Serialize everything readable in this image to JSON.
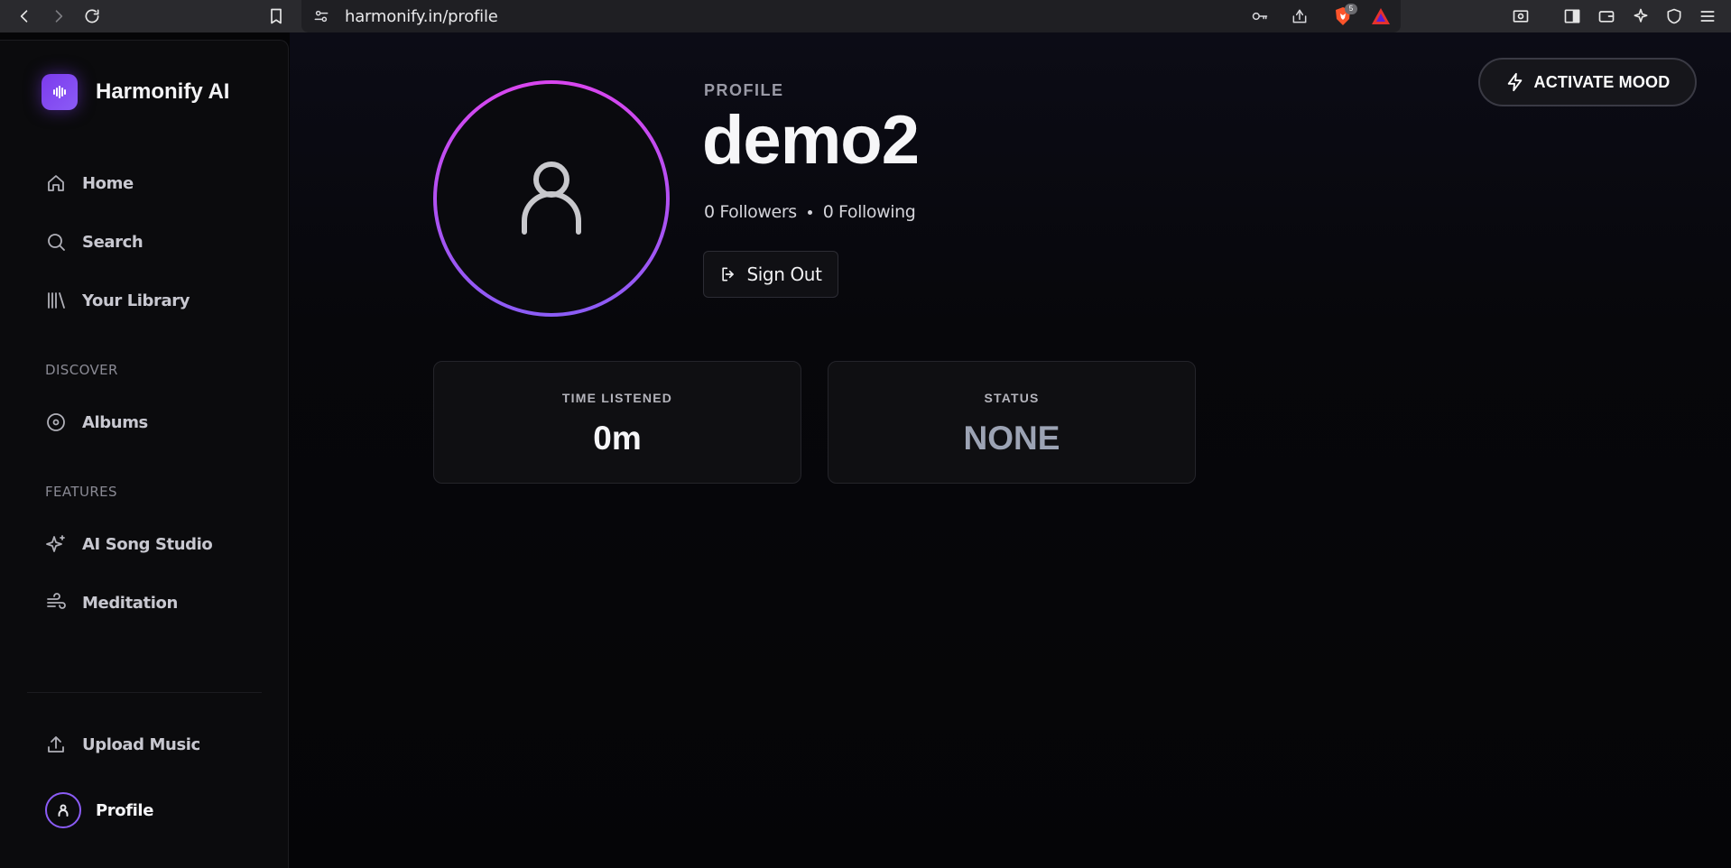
{
  "browser": {
    "url": "harmonify.in/profile",
    "shields_count": "5"
  },
  "sidebar": {
    "app_title": "Harmonify AI",
    "nav": [
      {
        "label": "Home",
        "icon": "home-icon"
      },
      {
        "label": "Search",
        "icon": "search-icon"
      },
      {
        "label": "Your Library",
        "icon": "library-icon"
      }
    ],
    "discover_label": "DISCOVER",
    "discover": [
      {
        "label": "Albums",
        "icon": "disc-icon"
      }
    ],
    "features_label": "FEATURES",
    "features": [
      {
        "label": "AI Song Studio",
        "icon": "sparkles-icon"
      },
      {
        "label": "Meditation",
        "icon": "wind-icon"
      }
    ],
    "upload_label": "Upload Music",
    "profile_label": "Profile"
  },
  "main": {
    "activate_label": "ACTIVATE MOOD",
    "kicker": "PROFILE",
    "username": "demo2",
    "followers": "0 Followers",
    "following": "0 Following",
    "signout_label": "Sign Out",
    "stats": [
      {
        "label": "TIME LISTENED",
        "value": "0m"
      },
      {
        "label": "STATUS",
        "value": "NONE"
      }
    ]
  },
  "colors": {
    "accent": "#8b5cf6",
    "accent_pink": "#d946ef",
    "background": "#050507"
  }
}
